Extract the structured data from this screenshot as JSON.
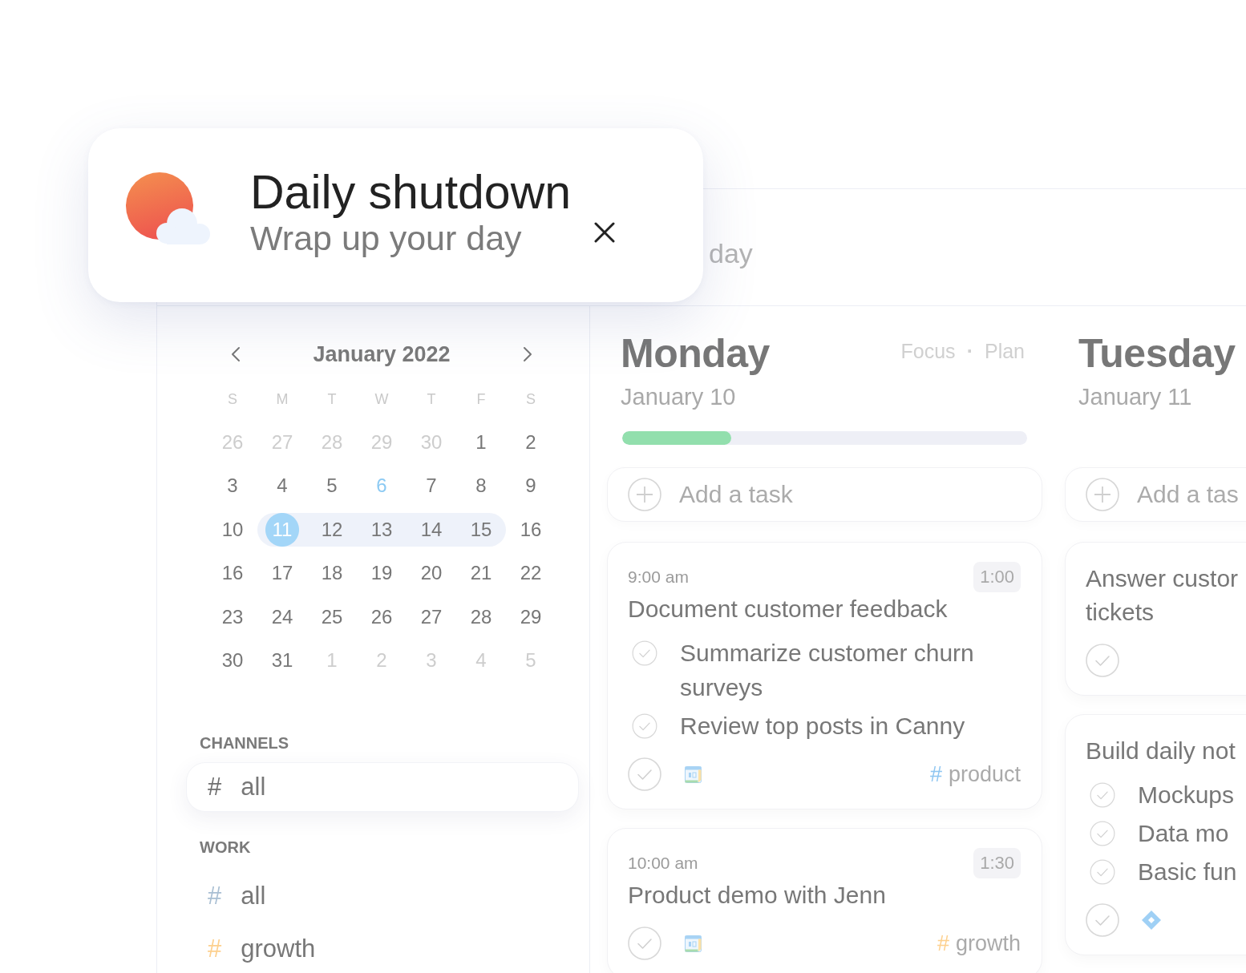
{
  "notification": {
    "title": "Daily shutdown",
    "subtitle": "Wrap up your day"
  },
  "top_bar": {
    "title": "day"
  },
  "calendar": {
    "month": "January 2022",
    "weekdays": [
      "S",
      "M",
      "T",
      "W",
      "T",
      "F",
      "S"
    ],
    "weeks": [
      {
        "days": [
          {
            "day": "26",
            "kind": "other_month",
            "selected": false
          },
          {
            "day": "27",
            "kind": "other_month",
            "selected": false
          },
          {
            "day": "28",
            "kind": "other_month",
            "selected": false
          },
          {
            "day": "29",
            "kind": "other_month",
            "selected": false
          },
          {
            "day": "30",
            "kind": "other_month",
            "selected": false
          },
          {
            "day": "1",
            "kind": "current",
            "selected": false
          },
          {
            "day": "2",
            "kind": "current",
            "selected": false
          }
        ]
      },
      {
        "days": [
          {
            "day": "3",
            "kind": "current",
            "selected": false
          },
          {
            "day": "4",
            "kind": "current",
            "selected": false
          },
          {
            "day": "5",
            "kind": "current",
            "selected": false
          },
          {
            "day": "6",
            "kind": "accent",
            "selected": false
          },
          {
            "day": "7",
            "kind": "current",
            "selected": false
          },
          {
            "day": "8",
            "kind": "current",
            "selected": false
          },
          {
            "day": "9",
            "kind": "current",
            "selected": false
          }
        ]
      },
      {
        "days": [
          {
            "day": "10",
            "kind": "current",
            "selected": false
          },
          {
            "day": "11",
            "kind": "today",
            "selected": true
          },
          {
            "day": "12",
            "kind": "current",
            "selected": true
          },
          {
            "day": "13",
            "kind": "current",
            "selected": true
          },
          {
            "day": "14",
            "kind": "current",
            "selected": true
          },
          {
            "day": "15",
            "kind": "current",
            "selected": true
          },
          {
            "day": "16",
            "kind": "current",
            "selected": false
          }
        ]
      },
      {
        "days": [
          {
            "day": "16",
            "kind": "current",
            "selected": false
          },
          {
            "day": "17",
            "kind": "current",
            "selected": false
          },
          {
            "day": "18",
            "kind": "current",
            "selected": false
          },
          {
            "day": "19",
            "kind": "current",
            "selected": false
          },
          {
            "day": "20",
            "kind": "current",
            "selected": false
          },
          {
            "day": "21",
            "kind": "current",
            "selected": false
          },
          {
            "day": "22",
            "kind": "current",
            "selected": false
          }
        ]
      },
      {
        "days": [
          {
            "day": "23",
            "kind": "current",
            "selected": false
          },
          {
            "day": "24",
            "kind": "current",
            "selected": false
          },
          {
            "day": "25",
            "kind": "current",
            "selected": false
          },
          {
            "day": "26",
            "kind": "current",
            "selected": false
          },
          {
            "day": "27",
            "kind": "current",
            "selected": false
          },
          {
            "day": "28",
            "kind": "current",
            "selected": false
          },
          {
            "day": "29",
            "kind": "current",
            "selected": false
          }
        ]
      },
      {
        "days": [
          {
            "day": "30",
            "kind": "current",
            "selected": false
          },
          {
            "day": "31",
            "kind": "current",
            "selected": false
          },
          {
            "day": "1",
            "kind": "other_month",
            "selected": false
          },
          {
            "day": "2",
            "kind": "other_month",
            "selected": false
          },
          {
            "day": "3",
            "kind": "other_month",
            "selected": false
          },
          {
            "day": "4",
            "kind": "other_month",
            "selected": false
          },
          {
            "day": "5",
            "kind": "other_month",
            "selected": false
          }
        ]
      }
    ]
  },
  "sidebar": {
    "groups": [
      {
        "heading": "CHANNELS",
        "items": [
          {
            "symbol": "#",
            "label": "all",
            "color": "#6f6f6f",
            "selected": true
          }
        ]
      },
      {
        "heading": "WORK",
        "items": [
          {
            "symbol": "#",
            "label": "all",
            "color": "#a9bfd3",
            "selected": false
          },
          {
            "symbol": "#",
            "label": "growth",
            "color": "#fdd08e",
            "selected": false
          }
        ]
      }
    ]
  },
  "columns": [
    {
      "day": "Monday",
      "date": "January 10",
      "actions": [
        {
          "label": "Focus"
        },
        {
          "label": "Plan"
        }
      ],
      "action_separator": "·",
      "progress": {
        "level": 0.27
      },
      "add_task": {
        "label": "Add a task"
      },
      "tasks": [
        {
          "time": "9:00 am",
          "duration": "1:00",
          "title_lines": [
            "Document customer feedback"
          ],
          "subtasks": [
            {
              "text": "Summarize customer churn surveys",
              "done": false
            },
            {
              "text": "Review top posts in Canny",
              "done": false
            }
          ],
          "done": false,
          "badge": {
            "kind": "calendar"
          },
          "tag": {
            "symbol": "#",
            "name": "product",
            "color": "#8fc6f1"
          }
        },
        {
          "time": "10:00 am",
          "duration": "1:30",
          "title_lines": [
            "Product demo with Jenn"
          ],
          "done": false,
          "badge": {
            "kind": "calendar"
          },
          "tag": {
            "symbol": "#",
            "name": "growth",
            "color": "#fdd08e"
          }
        }
      ]
    },
    {
      "day": "Tuesday",
      "date": "January 11",
      "add_task": {
        "label": "Add a tas"
      },
      "tasks": [
        {
          "title_lines": [
            "Answer custor",
            "tickets"
          ],
          "done": false
        },
        {
          "title_lines": [
            "Build daily not"
          ],
          "subtasks": [
            {
              "text": "Mockups",
              "done": false
            },
            {
              "text": "Data mo",
              "done": false
            },
            {
              "text": "Basic fun",
              "done": false
            }
          ],
          "done": false,
          "badge": {
            "kind": "diamond"
          }
        }
      ]
    }
  ]
}
